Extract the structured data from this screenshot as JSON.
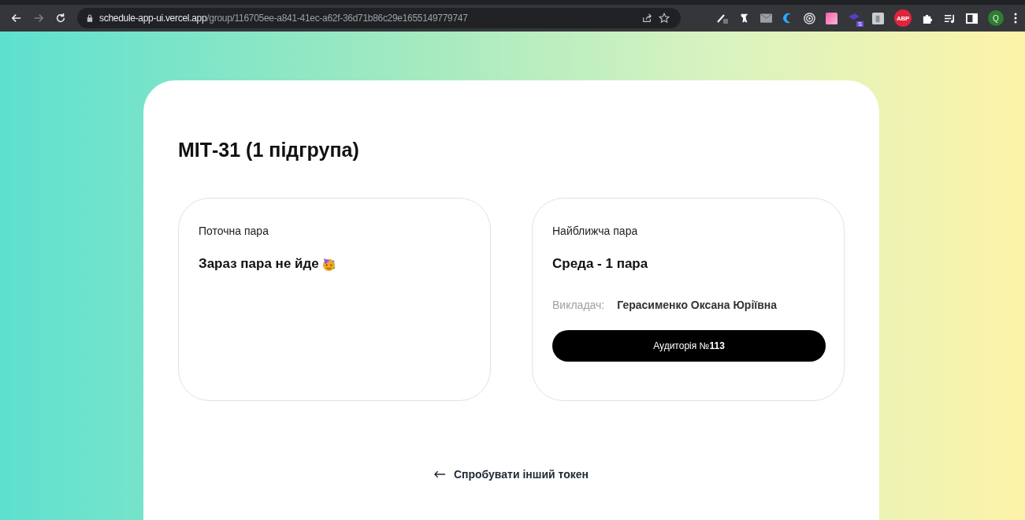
{
  "browser": {
    "url_host": "schedule-app-ui.vercel.app",
    "url_path": "/group/116705ee-a841-41ec-a62f-36d71b86c29e1655149779747",
    "extensions": [
      {
        "kind": "pen"
      },
      {
        "kind": "ninja"
      },
      {
        "kind": "mail"
      },
      {
        "kind": "crescent"
      },
      {
        "kind": "target"
      },
      {
        "kind": "square"
      },
      {
        "kind": "badge",
        "label": "S"
      },
      {
        "kind": "page"
      },
      {
        "kind": "abp",
        "label": "ABP"
      },
      {
        "kind": "puzzle"
      },
      {
        "kind": "playlist"
      },
      {
        "kind": "panel"
      }
    ],
    "profile": "Q"
  },
  "page": {
    "title": "МІТ-31 (1 підгрупа)",
    "cards": [
      {
        "kind": "current",
        "label": "Поточна пара",
        "heading": "Зараз пара не йде",
        "emoji": true
      },
      {
        "kind": "next",
        "label": "Найближча пара",
        "heading": "Среда - 1 пара",
        "teacher_label": "Викладач:",
        "teacher": "Герасименко Оксана Юріївна",
        "room": "Аудиторія №**113**"
      }
    ],
    "back_link": "Спробувати інший токен"
  }
}
